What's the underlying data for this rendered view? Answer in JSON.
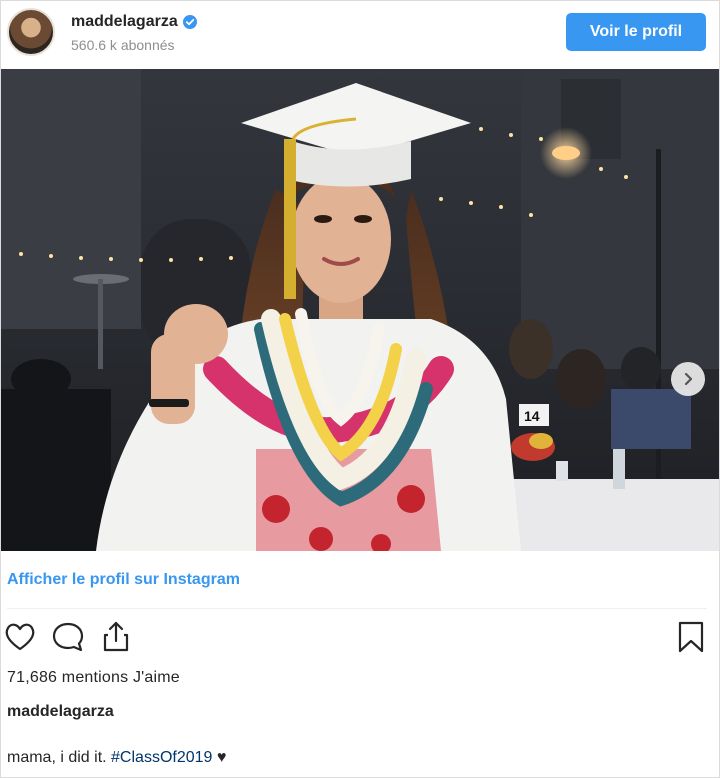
{
  "header": {
    "username": "maddelagarza",
    "followers": "560.6 k abonnés",
    "view_profile_button": "Voir le profil",
    "verified_icon": "verified-badge-icon",
    "avatar_alt": "avatar"
  },
  "photo": {
    "description_icon": "graduation-photo",
    "table_number": "14",
    "next_icon": "chevron-right-icon"
  },
  "links": {
    "view_on_instagram": "Afficher le profil sur Instagram"
  },
  "actions": {
    "like_icon": "heart-icon",
    "comment_icon": "comment-icon",
    "share_icon": "share-icon",
    "save_icon": "bookmark-icon"
  },
  "likes": {
    "count": "71,686",
    "label": "mentions J'aime"
  },
  "caption": {
    "username": "maddelagarza",
    "text": "mama, i did it. ",
    "hashtag": "#ClassOf2019",
    "emoji": "♥"
  },
  "colors": {
    "accent": "#3897f0",
    "text": "#262626",
    "muted": "#8e8e8e",
    "hashtag": "#003569"
  }
}
